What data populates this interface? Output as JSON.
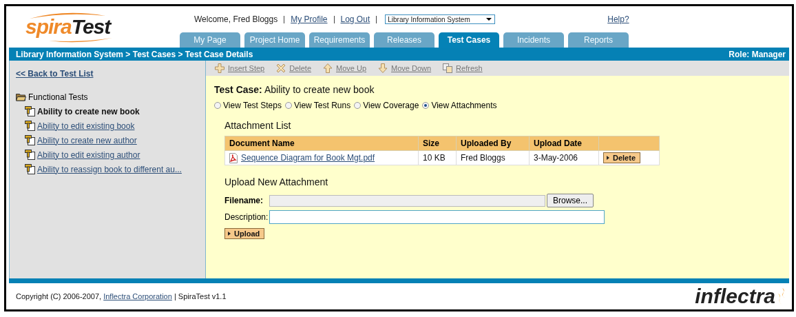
{
  "logo": {
    "part_1": "spira",
    "part_2": "Test"
  },
  "user_bar": {
    "welcome": "Welcome, Fred Bloggs",
    "links": [
      "My Profile",
      "Log Out"
    ],
    "project_select": "Library Information System",
    "help": "Help?"
  },
  "tabs": [
    {
      "label": "My Page",
      "selected": false
    },
    {
      "label": "Project Home",
      "selected": false
    },
    {
      "label": "Requirements",
      "selected": false
    },
    {
      "label": "Releases",
      "selected": false
    },
    {
      "label": "Test Cases",
      "selected": true
    },
    {
      "label": "Incidents",
      "selected": false
    },
    {
      "label": "Reports",
      "selected": false
    }
  ],
  "breadcrumb": "Library Information System > Test Cases > Test Case Details",
  "role": "Role: Manager",
  "sidebar": {
    "back_link": "<< Back to Test List",
    "folder": {
      "label": "Functional Tests",
      "children": [
        {
          "label": "Ability to create new book",
          "selected": true
        },
        {
          "label": "Ability to edit existing book",
          "selected": false
        },
        {
          "label": "Ability to create new author",
          "selected": false
        },
        {
          "label": "Ability to edit existing author",
          "selected": false
        },
        {
          "label": "Ability to reassign book to different au...",
          "selected": false
        }
      ]
    }
  },
  "toolbar": [
    {
      "label": "Insert Step",
      "kind": "insert"
    },
    {
      "label": "Delete",
      "kind": "delete"
    },
    {
      "label": "Move Up",
      "kind": "up"
    },
    {
      "label": "Move Down",
      "kind": "down"
    },
    {
      "label": "Refresh",
      "kind": "refresh"
    }
  ],
  "test_case": {
    "label": "Test Case:",
    "name": "Ability to create new book"
  },
  "view_options": [
    {
      "label": "View Test Steps",
      "selected": false
    },
    {
      "label": "View Test Runs",
      "selected": false
    },
    {
      "label": "View Coverage",
      "selected": false
    },
    {
      "label": "View Attachments",
      "selected": true
    }
  ],
  "attachments": {
    "title": "Attachment List",
    "columns": [
      "Document Name",
      "Size",
      "Uploaded By",
      "Upload Date"
    ],
    "rows": [
      {
        "document_name": "Sequence Diagram for Book Mgt.pdf",
        "size": "10 KB",
        "uploaded_by": "Fred Bloggs",
        "upload_date": "3-May-2006",
        "action": "Delete"
      }
    ]
  },
  "upload": {
    "title": "Upload New Attachment",
    "filename_label": "Filename:",
    "browse_button": "Browse...",
    "description_label": "Description:",
    "submit": "Upload"
  },
  "footer": {
    "copyright": "Copyright (C) 2006-2007,",
    "company_link": "Inflectra Corporation",
    "version": "| SpiraTest v1.1",
    "logo": "inflectra"
  }
}
